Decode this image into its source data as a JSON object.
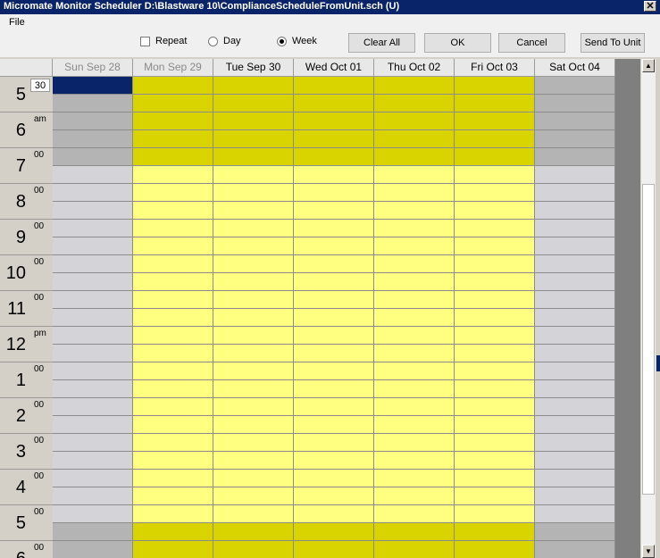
{
  "window": {
    "title": "Micromate Monitor Scheduler  D:\\Blastware 10\\ComplianceScheduleFromUnit.sch (U)",
    "close_glyph": "✕"
  },
  "menu": {
    "file": "File"
  },
  "toolbar": {
    "repeat_label": "Repeat",
    "day_label": "Day",
    "week_label": "Week",
    "clear_all_label": "Clear All",
    "ok_label": "OK",
    "cancel_label": "Cancel",
    "send_label": "Send To Unit"
  },
  "days": [
    {
      "label": "Sun Sep 28",
      "dim": true
    },
    {
      "label": "Mon Sep 29",
      "dim": true
    },
    {
      "label": "Tue Sep 30",
      "dim": false
    },
    {
      "label": "Wed Oct 01",
      "dim": false
    },
    {
      "label": "Thu Oct 02",
      "dim": false
    },
    {
      "label": "Fri Oct 03",
      "dim": false
    },
    {
      "label": "Sat Oct 04",
      "dim": false
    }
  ],
  "hours": [
    {
      "hour": "5",
      "minute": "30"
    },
    {
      "hour": "6",
      "minute": "am"
    },
    {
      "hour": "7",
      "minute": "00"
    },
    {
      "hour": "8",
      "minute": "00"
    },
    {
      "hour": "9",
      "minute": "00"
    },
    {
      "hour": "10",
      "minute": "00"
    },
    {
      "hour": "11",
      "minute": "00"
    },
    {
      "hour": "12",
      "minute": "pm"
    },
    {
      "hour": "1",
      "minute": "00"
    },
    {
      "hour": "2",
      "minute": "00"
    },
    {
      "hour": "3",
      "minute": "00"
    },
    {
      "hour": "4",
      "minute": "00"
    },
    {
      "hour": "5",
      "minute": "00"
    },
    {
      "hour": "6",
      "minute": "00"
    }
  ],
  "colors": {
    "weekday_active": "#ffff80",
    "weekday_edge": "#d9d400",
    "weekend": "#d4d3d7",
    "weekend_edge": "#b4b4b4",
    "selected": "#0a246a",
    "line": "#8c8c8c"
  }
}
